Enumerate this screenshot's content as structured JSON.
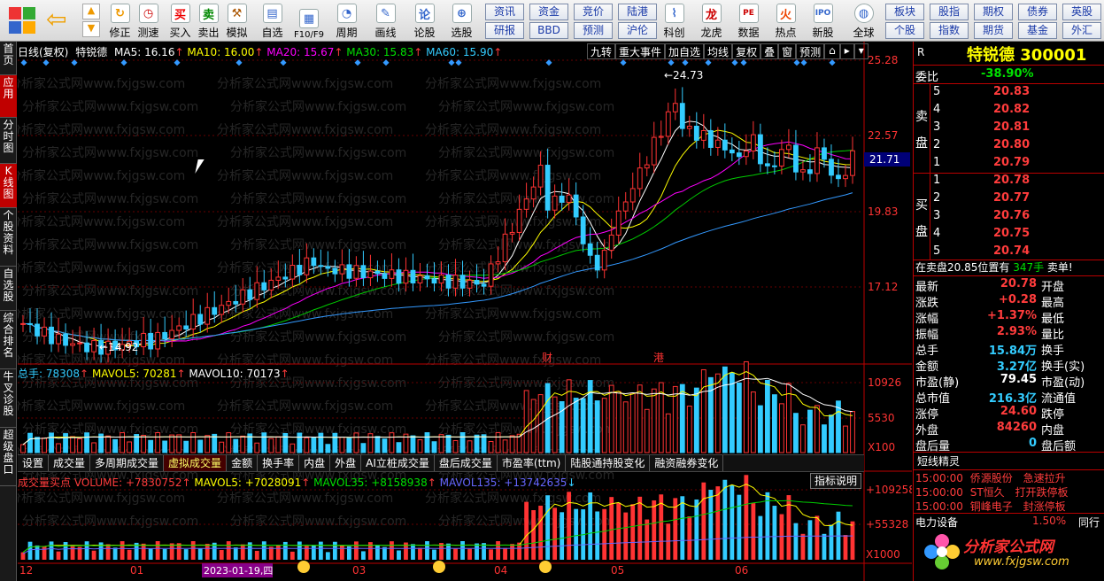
{
  "toolbar": {
    "buttons": [
      {
        "label": "修正"
      },
      {
        "label": "测速"
      },
      {
        "label": "买入"
      },
      {
        "label": "卖出"
      },
      {
        "label": "模拟"
      },
      {
        "label": "自选"
      },
      {
        "label": "F10/F9"
      },
      {
        "label": "周期"
      },
      {
        "label": "画线"
      },
      {
        "label": "论股"
      },
      {
        "label": "选股"
      },
      {
        "label": "科创"
      },
      {
        "label": "龙虎"
      },
      {
        "label": "数据"
      },
      {
        "label": "热点"
      },
      {
        "label": "新股"
      },
      {
        "label": "全球"
      }
    ],
    "links": [
      "资讯",
      "资金",
      "竞价",
      "陆港",
      "研报",
      "BBD",
      "预测",
      "沪伦",
      "板块",
      "股指",
      "期权",
      "债券",
      "英股",
      "个股",
      "指数",
      "期货",
      "基金",
      "外汇"
    ]
  },
  "sidebar": [
    "首页",
    "应用",
    "分时图",
    "K线图",
    "个股资料",
    "自选股",
    "综合排名",
    "牛叉诊股",
    "超级盘口"
  ],
  "chart": {
    "header": {
      "period": "日线(复权)",
      "name": "特锐德",
      "ma5": "MA5: 16.16",
      "ma10": "MA10: 16.00",
      "ma20": "MA20: 15.67",
      "ma30": "MA30: 15.83",
      "ma60": "MA60: 15.90"
    },
    "top_buttons": [
      "九转",
      "重大事件",
      "加自选",
      "均线",
      "复权",
      "叠",
      "窗",
      "预测"
    ],
    "price_ticks": [
      "25.28",
      "22.57",
      "19.83",
      "17.12"
    ],
    "current_price": "21.71",
    "high_label": "24.73",
    "low_label": "14.92",
    "markers": [
      "财",
      "港"
    ],
    "vol_header": {
      "total": "总手: 78308",
      "mavol5": "MAVOL5: 70281",
      "mavol10": "MAVOL10: 70173"
    },
    "vol_ticks": [
      "10926",
      "5530",
      "X100"
    ],
    "tabs": [
      "设置",
      "成交量",
      "多周期成交量",
      "虚拟成交量",
      "金额",
      "换手率",
      "内盘",
      "外盘",
      "AI立桩成交量",
      "盘后成交量",
      "市盈率(ttm)",
      "陆股通持股变化",
      "融资融券变化"
    ],
    "indicator_btn": "指标说明",
    "ind_header": {
      "title": "成交量买点",
      "volume": "VOLUME: +7830752",
      "mavol5": "MAVOL5: +7028091",
      "mavol35": "MAVOL35: +8158938",
      "mavol135": "MAVOL135: +13742635"
    },
    "ind_ticks": [
      "+109258",
      "+55328",
      "X1000"
    ],
    "x_axis": [
      "12",
      "01",
      "2023-01-19,四",
      "03",
      "04",
      "05",
      "06"
    ],
    "watermark": "分析家公式网www.fxjgsw.com"
  },
  "quote": {
    "r": "R",
    "name": "特锐德",
    "code": "300001",
    "weibi_label": "委比",
    "weibi": "-38.90%",
    "sell_label": "卖盘",
    "buy_label": "买盘",
    "sell": [
      {
        "n": "5",
        "p": "20.83"
      },
      {
        "n": "4",
        "p": "20.82"
      },
      {
        "n": "3",
        "p": "20.81"
      },
      {
        "n": "2",
        "p": "20.80"
      },
      {
        "n": "1",
        "p": "20.79"
      }
    ],
    "buy": [
      {
        "n": "1",
        "p": "20.78"
      },
      {
        "n": "2",
        "p": "20.77"
      },
      {
        "n": "3",
        "p": "20.76"
      },
      {
        "n": "4",
        "p": "20.75"
      },
      {
        "n": "5",
        "p": "20.74"
      }
    ],
    "notice": "在卖盘20.85位置有",
    "notice_vol": "347手",
    "notice_act": "卖单!",
    "stats": [
      {
        "l": "最新",
        "v": "20.78",
        "r": "开盘"
      },
      {
        "l": "涨跌",
        "v": "+0.28",
        "r": "最高"
      },
      {
        "l": "涨幅",
        "v": "+1.37%",
        "r": "最低"
      },
      {
        "l": "振幅",
        "v": "2.93%",
        "r": "量比"
      },
      {
        "l": "总手",
        "v": "15.84万",
        "r": "换手"
      },
      {
        "l": "金额",
        "v": "3.27亿",
        "r": "换手(实)"
      },
      {
        "l": "市盈(静)",
        "v": "79.45",
        "r": "市盈(动)"
      },
      {
        "l": "总市值",
        "v": "216.3亿",
        "r": "流通值"
      },
      {
        "l": "涨停",
        "v": "24.60",
        "r": "跌停"
      },
      {
        "l": "外盘",
        "v": "84260",
        "r": "内盘"
      },
      {
        "l": "盘后量",
        "v": "0",
        "r": "盘后额"
      }
    ],
    "short_title": "短线精灵",
    "short": [
      {
        "t": "15:00:00",
        "s": "侨源股份",
        "e": "急速拉升"
      },
      {
        "t": "15:00:00",
        "s": "ST恒久",
        "e": "打开跌停板"
      },
      {
        "t": "15:00:00",
        "s": "铜峰电子",
        "e": "封涨停板"
      }
    ],
    "bottom": {
      "name": "电力设备",
      "pct": "1.50%",
      "tail": "同行"
    },
    "logo_text": "分析家公式网",
    "logo_url": "www.fxjgsw.com"
  }
}
